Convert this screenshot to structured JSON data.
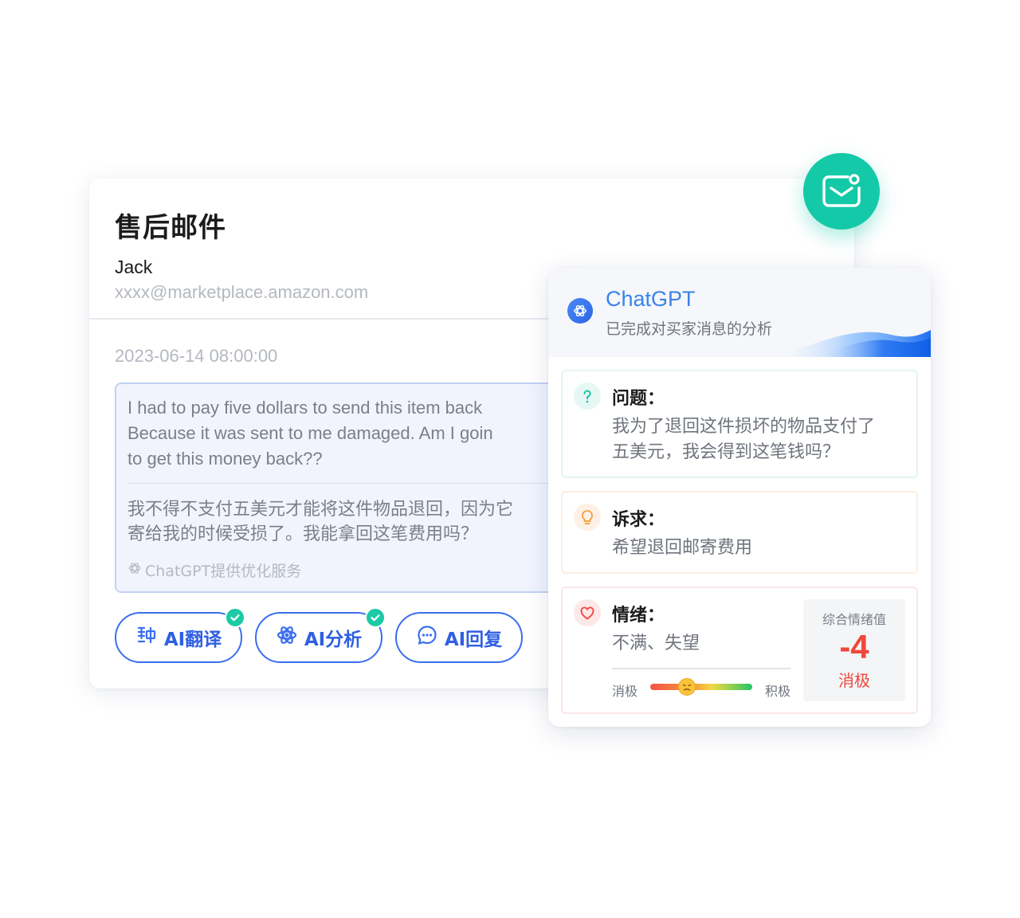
{
  "email": {
    "title": "售后邮件",
    "sender_name": "Jack",
    "sender_email": "xxxx@marketplace.amazon.com",
    "timestamp": "2023-06-14 08:00:00",
    "message_en": [
      "I had to pay five dollars to send this item back",
      "Because it was sent to me damaged. Am I goin",
      "to get this money back??"
    ],
    "message_zh": [
      "我不得不支付五美元才能将这件物品退回，因为它",
      "寄给我的时候受损了。我能拿回这笔费用吗？"
    ],
    "service_note": "ChatGPT提供优化服务"
  },
  "actions": {
    "translate": "AI翻译",
    "analyze": "AI分析",
    "reply": "AI回复"
  },
  "analysis": {
    "title": "ChatGPT",
    "subtitle": "已完成对买家消息的分析",
    "question_label": "问题：",
    "question_text": "我为了退回这件损坏的物品支付了五美元，我会得到这笔钱吗？",
    "demand_label": "诉求：",
    "demand_text": "希望退回邮寄费用",
    "emotion_label": "情绪：",
    "emotion_text": "不满、失望",
    "scale_negative": "消极",
    "scale_positive": "积极",
    "scale_position": 0.36,
    "score_label": "综合情绪值",
    "score_value": "-4",
    "score_tag": "消极"
  },
  "colors": {
    "accent_blue": "#2f5fe3",
    "teal": "#14c9a8",
    "negative_red": "#f0473a"
  },
  "icons": {
    "mail_bubble": "mail-notification-icon",
    "translate": "translate-icon",
    "analyze": "atom-icon",
    "reply": "chat-bubble-icon",
    "question": "question-icon",
    "demand": "lightbulb-icon",
    "emotion": "heart-icon"
  }
}
